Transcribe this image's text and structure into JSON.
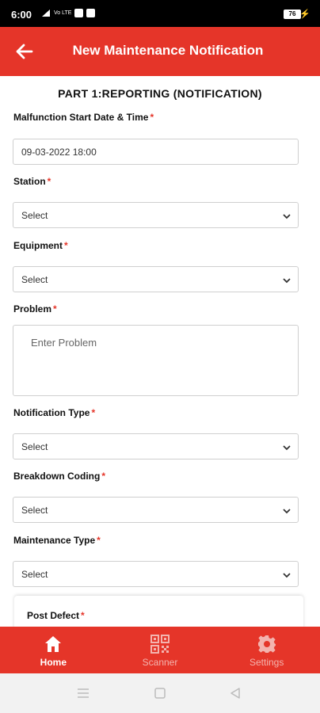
{
  "status_bar": {
    "time": "6:00",
    "network_text": "Vo LTE",
    "battery": "76"
  },
  "app_bar": {
    "title": "New Maintenance Notification",
    "back_icon": "arrow-left-icon"
  },
  "form": {
    "part_title": "PART 1:REPORTING (NOTIFICATION)",
    "required_mark": "*",
    "fields": [
      {
        "label": "Malfunction Start Date & Time",
        "value": "09-03-2022 18:00"
      },
      {
        "label": "Station",
        "value": "Select"
      },
      {
        "label": "Equipment",
        "value": "Select"
      },
      {
        "label": "Problem",
        "placeholder": "Enter Problem"
      },
      {
        "label": "Notification Type",
        "value": "Select"
      },
      {
        "label": "Breakdown Coding",
        "value": "Select"
      },
      {
        "label": "Maintenance Type",
        "value": "Select"
      }
    ],
    "part2_label": "Post Defect"
  },
  "bottom_nav": {
    "items": [
      {
        "label": "Home",
        "icon": "home-icon",
        "active": true
      },
      {
        "label": "Scanner",
        "icon": "qr-scanner-icon",
        "active": false
      },
      {
        "label": "Settings",
        "icon": "gear-icon",
        "active": false
      }
    ]
  },
  "colors": {
    "primary": "#e53529",
    "inactive_nav": "#f3b3ae"
  }
}
